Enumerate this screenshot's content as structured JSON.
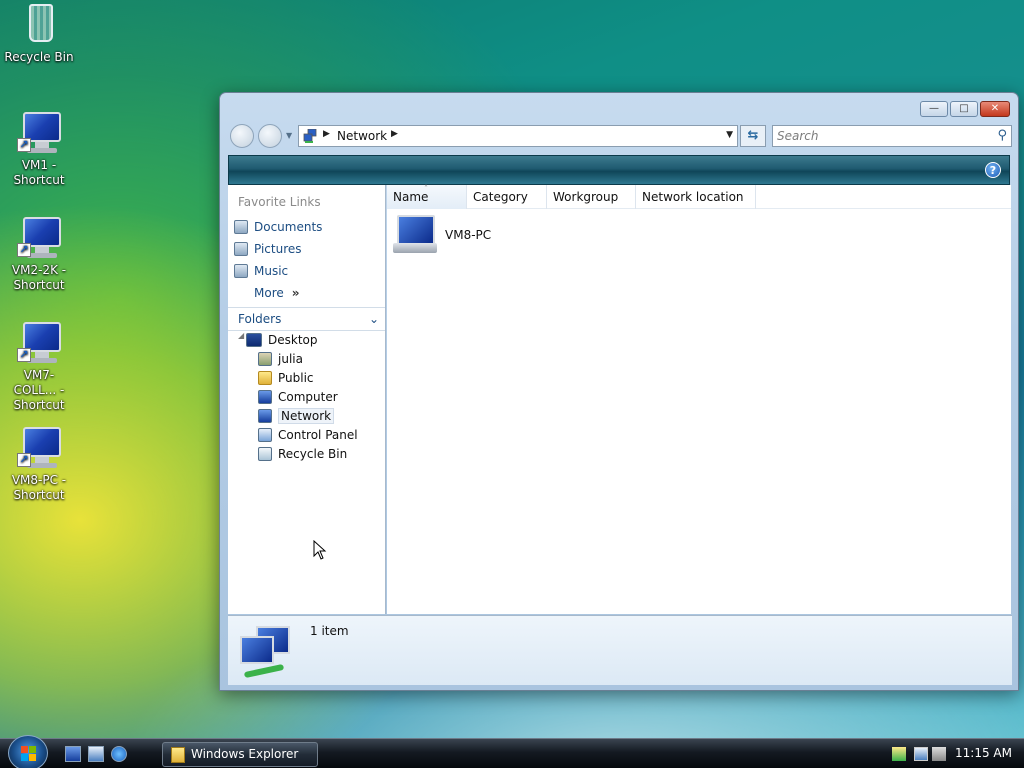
{
  "desktop": {
    "icons": [
      {
        "label": "Recycle Bin",
        "icon": "recycle-bin-icon"
      },
      {
        "label": "VM1 - Shortcut",
        "icon": "computer-shortcut-icon"
      },
      {
        "label": "VM2-2K - Shortcut",
        "icon": "computer-shortcut-icon"
      },
      {
        "label": "VM7-COLL... - Shortcut",
        "icon": "computer-shortcut-icon"
      },
      {
        "label": "VM8-PC - Shortcut",
        "icon": "computer-shortcut-icon"
      }
    ]
  },
  "window": {
    "title_buttons": {
      "minimize": "—",
      "maximize": "□",
      "close": "✕"
    },
    "address": {
      "crumb": "Network",
      "separator": "▶",
      "dropdown": "▼"
    },
    "search": {
      "placeholder": "Search",
      "icon": "magnifier-icon"
    },
    "refresh": "⇆",
    "help": "?",
    "nav_dropdown": "▼"
  },
  "nav_pane": {
    "favorite_links_title": "Favorite Links",
    "favorites": [
      {
        "label": "Documents"
      },
      {
        "label": "Pictures"
      },
      {
        "label": "Music"
      },
      {
        "label": "More"
      }
    ],
    "more_chevron": "»",
    "folders_title": "Folders",
    "folders_chevron": "⌄",
    "tree": [
      {
        "label": "Desktop",
        "icon": "desktop-icon"
      },
      {
        "label": "julia",
        "icon": "user-folder-icon"
      },
      {
        "label": "Public",
        "icon": "folder-icon"
      },
      {
        "label": "Computer",
        "icon": "computer-icon"
      },
      {
        "label": "Network",
        "icon": "network-icon",
        "selected": true
      },
      {
        "label": "Control Panel",
        "icon": "control-panel-icon"
      },
      {
        "label": "Recycle Bin",
        "icon": "recycle-bin-icon"
      }
    ],
    "tree_expander": "◢"
  },
  "content": {
    "columns": [
      {
        "label": "Name",
        "sorted": true
      },
      {
        "label": "Category"
      },
      {
        "label": "Workgroup"
      },
      {
        "label": "Network location"
      }
    ],
    "sort_arrow": "˄",
    "items": [
      {
        "name": "VM8-PC",
        "icon": "computer-icon"
      }
    ]
  },
  "details": {
    "count_text": "1 item",
    "icon": "network-icon"
  },
  "taskbar": {
    "task_label": "Windows Explorer",
    "clock": "11:15 AM",
    "quick_launch": [
      "show-desktop-icon",
      "switch-windows-icon",
      "internet-explorer-icon"
    ],
    "tray_icons": [
      "network-connected-icon",
      "network-icon",
      "volume-muted-icon"
    ]
  },
  "colors": {
    "accent": "#1c4d82",
    "toolbar": "#1f5a70",
    "taskbar": "#141a22"
  }
}
